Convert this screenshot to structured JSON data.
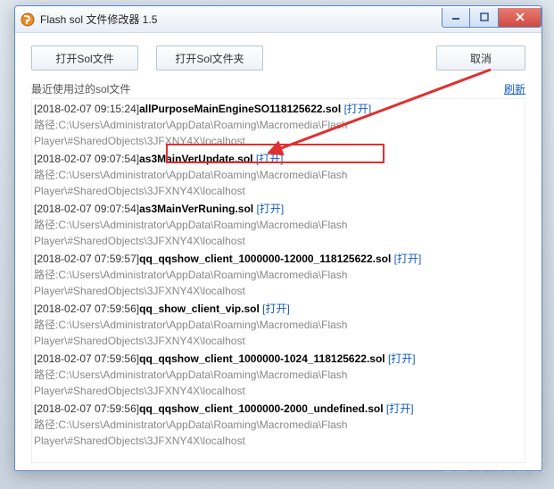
{
  "window": {
    "title": "Flash sol 文件修改器 1.5"
  },
  "toolbar": {
    "openFile": "打开Sol文件",
    "openFolder": "打开Sol文件夹",
    "cancel": "取消"
  },
  "recent": {
    "label": "最近使用过的sol文件",
    "refresh": "刷新",
    "openAction": "[打开]",
    "pathPrefix": "路径:",
    "commonPath": "C:\\Users\\Administrator\\AppData\\Roaming\\Macromedia\\Flash Player\\#SharedObjects\\3JFXNY4X\\localhost",
    "items": [
      {
        "ts": "[2018-02-07 09:15:24]",
        "name": "allPurposeMainEngineSO118125622.sol"
      },
      {
        "ts": "[2018-02-07 09:07:54]",
        "name": "as3MainVerUpdate.sol"
      },
      {
        "ts": "[2018-02-07 09:07:54]",
        "name": "as3MainVerRuning.sol"
      },
      {
        "ts": "[2018-02-07 07:59:57]",
        "name": "qq_qqshow_client_1000000-12000_118125622.sol"
      },
      {
        "ts": "[2018-02-07 07:59:56]",
        "name": "qq_show_client_vip.sol"
      },
      {
        "ts": "[2018-02-07 07:59:56]",
        "name": "qq_qqshow_client_1000000-1024_118125622.sol"
      },
      {
        "ts": "[2018-02-07 07:59:56]",
        "name": "qq_qqshow_client_1000000-2000_undefined.sol"
      }
    ]
  },
  "watermark": "系统之家"
}
